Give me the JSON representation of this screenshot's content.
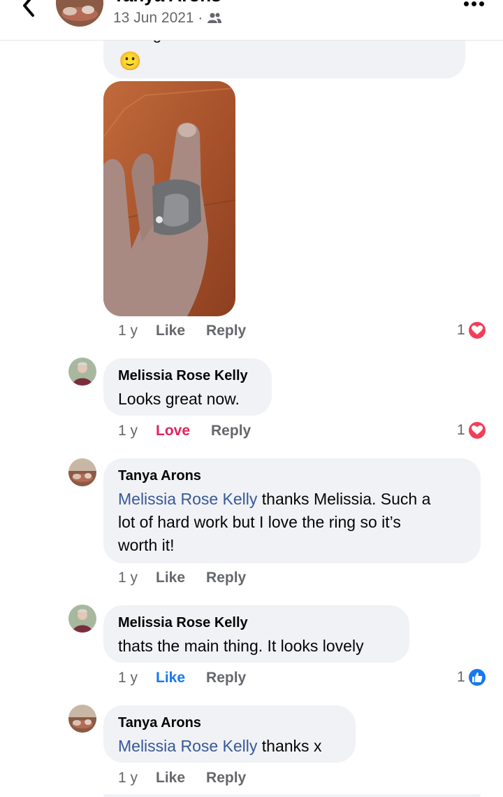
{
  "header": {
    "name": "Tanya Arons",
    "date": "13 Jun 2021 ·",
    "back_icon": "chevron-left-icon",
    "audience_icon": "friends-icon",
    "more_icon": "more-dots-icon"
  },
  "first_comment": {
    "text_partial": "Brought it down a size so it fits me better.",
    "emoji": "🙂",
    "photo_icon": "ring-photo",
    "actions": {
      "time": "1 y",
      "like": "Like",
      "reply": "Reply"
    },
    "reaction": {
      "count": "1",
      "type": "love-reaction-icon"
    }
  },
  "comments": [
    {
      "author": "Melissia Rose Kelly",
      "text": "Looks great now.",
      "actions": {
        "time": "1 y",
        "like": "Love",
        "reply": "Reply"
      },
      "reaction": {
        "count": "1",
        "type": "love-reaction-icon"
      }
    },
    {
      "author": "Tanya Arons",
      "mention": "Melissia Rose Kelly",
      "text_line1": " thanks Melissia.  Such a",
      "text_line2": "lot of hard work but I love the ring so it’s",
      "text_line3": "worth it!",
      "actions": {
        "time": "1 y",
        "like": "Like",
        "reply": "Reply"
      }
    },
    {
      "author": "Melissia Rose Kelly",
      "text": "thats the main thing. It looks lovely",
      "actions": {
        "time": "1 y",
        "like": "Like",
        "reply": "Reply"
      },
      "reaction": {
        "count": "1",
        "type": "like-reaction-icon"
      }
    },
    {
      "author": "Tanya Arons",
      "mention": "Melissia Rose Kelly",
      "text": " thanks x",
      "actions": {
        "time": "1 y",
        "like": "Like",
        "reply": "Reply"
      }
    }
  ],
  "colors": {
    "bubble": "#f0f2f5",
    "secondary_text": "#65676b",
    "mention": "#385898",
    "love": "#e0245e",
    "like_blue": "#1877f2"
  }
}
